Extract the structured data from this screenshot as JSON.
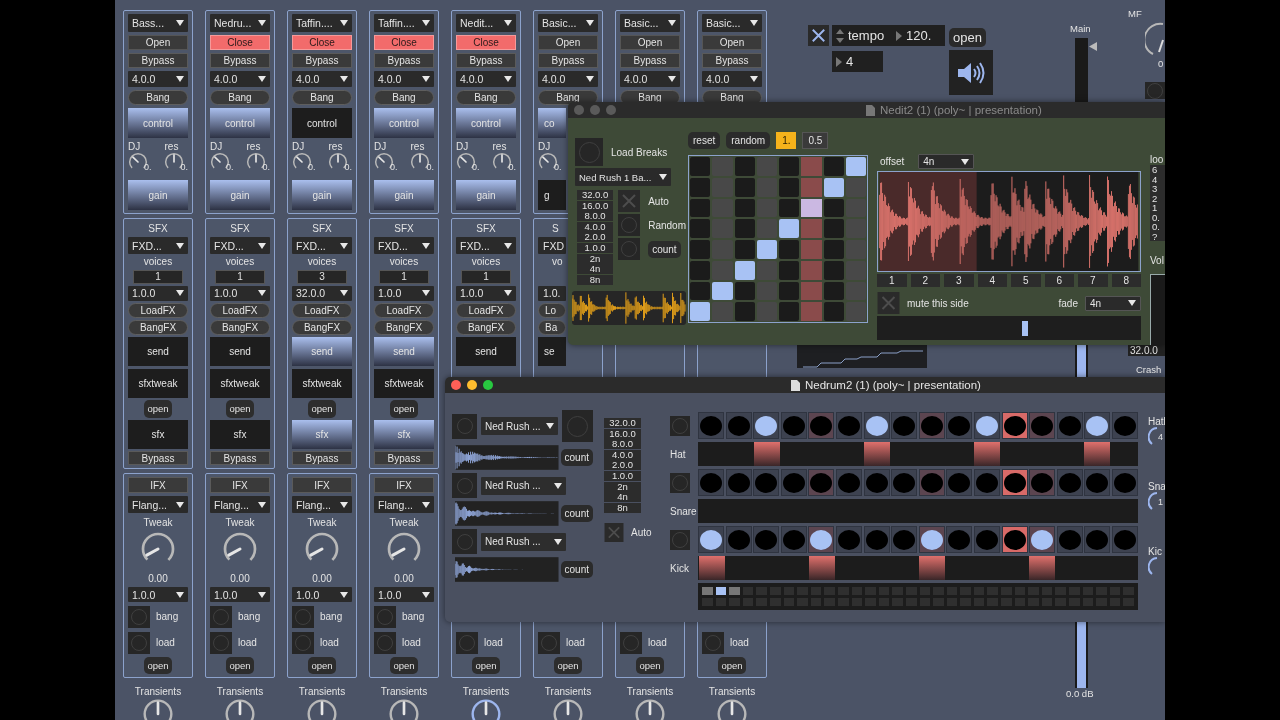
{
  "strips": [
    {
      "top": [
        {
          "kind": "preset",
          "text": "Bass..."
        },
        {
          "kind": "switch",
          "text": "Open",
          "on": false
        },
        {
          "kind": "bypass",
          "text": "Bypass"
        },
        {
          "kind": "rate",
          "text": "4.0.0"
        },
        {
          "kind": "bang",
          "text": "Bang"
        },
        {
          "kind": "control",
          "text": "control",
          "on": true
        },
        {
          "kind": "knobs",
          "knobs": [
            {
              "label": "DJ",
              "reading": "0."
            },
            {
              "label": "res",
              "reading": "0."
            }
          ]
        },
        {
          "kind": "gain",
          "text": "gain",
          "on": true
        }
      ],
      "sfx": [
        {
          "kind": "title",
          "text": "SFX"
        },
        {
          "kind": "effect",
          "text": "FXD..."
        },
        {
          "kind": "caption",
          "text": "voices"
        },
        {
          "kind": "voices",
          "text": "1"
        },
        {
          "kind": "rate",
          "text": "1.0.0"
        },
        {
          "kind": "load",
          "text": "LoadFX"
        },
        {
          "kind": "trigger",
          "text": "BangFX"
        },
        {
          "kind": "send",
          "text": "send",
          "on": false
        },
        {
          "kind": "tweak",
          "text": "sfxtweak"
        },
        {
          "kind": "open",
          "text": "open"
        },
        {
          "kind": "sfx",
          "text": "sfx",
          "on": false
        },
        {
          "kind": "bypass",
          "text": "Bypass"
        }
      ],
      "ifx": [
        {
          "kind": "tag",
          "text": "IFX"
        },
        {
          "kind": "effect",
          "text": "Flang..."
        },
        {
          "kind": "caption",
          "text": "Tweak"
        },
        {
          "kind": "dial"
        },
        {
          "kind": "reading",
          "text": "0.00"
        },
        {
          "kind": "rate",
          "text": "1.0.0"
        },
        {
          "kind": "bang",
          "text": "bang"
        },
        {
          "kind": "load",
          "text": "load"
        },
        {
          "kind": "open",
          "text": "open"
        }
      ],
      "transients": {
        "label": "Transients",
        "focused": false
      }
    },
    {
      "top": [
        {
          "kind": "preset",
          "text": "Nedru..."
        },
        {
          "kind": "switch",
          "text": "Close",
          "on": true
        },
        {
          "kind": "bypass",
          "text": "Bypass"
        },
        {
          "kind": "rate",
          "text": "4.0.0"
        },
        {
          "kind": "bang",
          "text": "Bang"
        },
        {
          "kind": "control",
          "text": "control",
          "on": true
        },
        {
          "kind": "knobs",
          "knobs": [
            {
              "label": "DJ",
              "reading": "0."
            },
            {
              "label": "res",
              "reading": "0."
            }
          ]
        },
        {
          "kind": "gain",
          "text": "gain",
          "on": true
        }
      ],
      "sfx": [
        {
          "kind": "title",
          "text": "SFX"
        },
        {
          "kind": "effect",
          "text": "FXD..."
        },
        {
          "kind": "caption",
          "text": "voices"
        },
        {
          "kind": "voices",
          "text": "1"
        },
        {
          "kind": "rate",
          "text": "1.0.0"
        },
        {
          "kind": "load",
          "text": "LoadFX"
        },
        {
          "kind": "trigger",
          "text": "BangFX"
        },
        {
          "kind": "send",
          "text": "send",
          "on": false
        },
        {
          "kind": "tweak",
          "text": "sfxtweak"
        },
        {
          "kind": "open",
          "text": "open"
        },
        {
          "kind": "sfx",
          "text": "sfx",
          "on": false
        },
        {
          "kind": "bypass",
          "text": "Bypass"
        }
      ],
      "ifx": [
        {
          "kind": "tag",
          "text": "IFX"
        },
        {
          "kind": "effect",
          "text": "Flang..."
        },
        {
          "kind": "caption",
          "text": "Tweak"
        },
        {
          "kind": "dial"
        },
        {
          "kind": "reading",
          "text": "0.00"
        },
        {
          "kind": "rate",
          "text": "1.0.0"
        },
        {
          "kind": "bang",
          "text": "bang"
        },
        {
          "kind": "load",
          "text": "load"
        },
        {
          "kind": "open",
          "text": "open"
        }
      ],
      "transients": {
        "label": "Transients",
        "focused": false
      }
    },
    {
      "top": [
        {
          "kind": "preset",
          "text": "Taffin...."
        },
        {
          "kind": "switch",
          "text": "Close",
          "on": true
        },
        {
          "kind": "bypass",
          "text": "Bypass"
        },
        {
          "kind": "rate",
          "text": "4.0.0"
        },
        {
          "kind": "bang",
          "text": "Bang"
        },
        {
          "kind": "control",
          "text": "control",
          "on": false
        },
        {
          "kind": "knobs",
          "knobs": [
            {
              "label": "DJ",
              "reading": "0."
            },
            {
              "label": "res",
              "reading": "0."
            }
          ]
        },
        {
          "kind": "gain",
          "text": "gain",
          "on": true
        }
      ],
      "sfx": [
        {
          "kind": "title",
          "text": "SFX"
        },
        {
          "kind": "effect",
          "text": "FXD..."
        },
        {
          "kind": "caption",
          "text": "voices"
        },
        {
          "kind": "voices",
          "text": "3"
        },
        {
          "kind": "rate",
          "text": "32.0.0"
        },
        {
          "kind": "load",
          "text": "LoadFX"
        },
        {
          "kind": "trigger",
          "text": "BangFX"
        },
        {
          "kind": "send",
          "text": "send",
          "on": true
        },
        {
          "kind": "tweak",
          "text": "sfxtweak"
        },
        {
          "kind": "open",
          "text": "open"
        },
        {
          "kind": "sfx",
          "text": "sfx",
          "on": true
        },
        {
          "kind": "bypass",
          "text": "Bypass"
        }
      ],
      "ifx": [
        {
          "kind": "tag",
          "text": "IFX"
        },
        {
          "kind": "effect",
          "text": "Flang..."
        },
        {
          "kind": "caption",
          "text": "Tweak"
        },
        {
          "kind": "dial"
        },
        {
          "kind": "reading",
          "text": "0.00"
        },
        {
          "kind": "rate",
          "text": "1.0.0"
        },
        {
          "kind": "bang",
          "text": "bang"
        },
        {
          "kind": "load",
          "text": "load"
        },
        {
          "kind": "open",
          "text": "open"
        }
      ],
      "transients": {
        "label": "Transients",
        "focused": false
      }
    },
    {
      "top": [
        {
          "kind": "preset",
          "text": "Taffin...."
        },
        {
          "kind": "switch",
          "text": "Close",
          "on": true
        },
        {
          "kind": "bypass",
          "text": "Bypass"
        },
        {
          "kind": "rate",
          "text": "4.0.0"
        },
        {
          "kind": "bang",
          "text": "Bang"
        },
        {
          "kind": "control",
          "text": "control",
          "on": true
        },
        {
          "kind": "knobs",
          "knobs": [
            {
              "label": "DJ",
              "reading": "0."
            },
            {
              "label": "res",
              "reading": "0."
            }
          ]
        },
        {
          "kind": "gain",
          "text": "gain",
          "on": true
        }
      ],
      "sfx": [
        {
          "kind": "title",
          "text": "SFX"
        },
        {
          "kind": "effect",
          "text": "FXD..."
        },
        {
          "kind": "caption",
          "text": "voices"
        },
        {
          "kind": "voices",
          "text": "1"
        },
        {
          "kind": "rate",
          "text": "1.0.0"
        },
        {
          "kind": "load",
          "text": "LoadFX"
        },
        {
          "kind": "trigger",
          "text": "BangFX"
        },
        {
          "kind": "send",
          "text": "send",
          "on": true
        },
        {
          "kind": "tweak",
          "text": "sfxtweak"
        },
        {
          "kind": "open",
          "text": "open"
        },
        {
          "kind": "sfx",
          "text": "sfx",
          "on": true
        },
        {
          "kind": "bypass",
          "text": "Bypass"
        }
      ],
      "ifx": [
        {
          "kind": "tag",
          "text": "IFX"
        },
        {
          "kind": "effect",
          "text": "Flang..."
        },
        {
          "kind": "caption",
          "text": "Tweak"
        },
        {
          "kind": "dial"
        },
        {
          "kind": "reading",
          "text": "0.00"
        },
        {
          "kind": "rate",
          "text": "1.0.0"
        },
        {
          "kind": "bang",
          "text": "bang"
        },
        {
          "kind": "load",
          "text": "load"
        },
        {
          "kind": "open",
          "text": "open"
        }
      ],
      "transients": {
        "label": "Transients",
        "focused": false
      }
    },
    {
      "top": [
        {
          "kind": "preset",
          "text": "Nedit..."
        },
        {
          "kind": "switch",
          "text": "Close",
          "on": true
        },
        {
          "kind": "bypass",
          "text": "Bypass"
        },
        {
          "kind": "rate",
          "text": "4.0.0"
        },
        {
          "kind": "bang",
          "text": "Bang"
        },
        {
          "kind": "control",
          "text": "control",
          "on": true
        },
        {
          "kind": "knobs",
          "knobs": [
            {
              "label": "DJ",
              "reading": "0."
            },
            {
              "label": "res",
              "reading": "0."
            }
          ]
        },
        {
          "kind": "gain",
          "text": "gain",
          "on": true
        }
      ],
      "sfx": [
        {
          "kind": "title",
          "text": "SFX"
        },
        {
          "kind": "effect",
          "text": "FXD..."
        },
        {
          "kind": "caption",
          "text": "voices"
        },
        {
          "kind": "voices",
          "text": "1"
        },
        {
          "kind": "rate",
          "text": "1.0.0"
        },
        {
          "kind": "load",
          "text": "LoadFX"
        },
        {
          "kind": "trigger",
          "text": "BangFX"
        },
        {
          "kind": "send",
          "text": "send",
          "on": false
        }
      ],
      "ifx": [
        {
          "kind": "load",
          "text": "load"
        },
        {
          "kind": "open",
          "text": "open"
        }
      ],
      "transients": {
        "label": "Transients",
        "focused": true
      }
    },
    {
      "top": [
        {
          "kind": "preset",
          "text": "Basic..."
        },
        {
          "kind": "switch",
          "text": "Open",
          "on": false
        },
        {
          "kind": "bypass",
          "text": "Bypass"
        },
        {
          "kind": "rate",
          "text": "4.0.0"
        },
        {
          "kind": "bang",
          "text": "Bang"
        },
        {
          "kind": "control",
          "text": "co",
          "on": true,
          "cut": true
        },
        {
          "kind": "knobs",
          "knobs": [
            {
              "label": "DJ",
              "reading": "0."
            }
          ]
        },
        {
          "kind": "gain",
          "text": "g",
          "on": false,
          "cut": true
        }
      ],
      "sfx": [
        {
          "kind": "title",
          "text": "S",
          "cut": true
        },
        {
          "kind": "effect",
          "text": "FXD",
          "cut": true
        },
        {
          "kind": "caption",
          "text": "vo",
          "cut": true
        },
        {
          "kind": "rate",
          "text": "1.0.",
          "cut": true
        },
        {
          "kind": "load",
          "text": "Lo",
          "cut": true
        },
        {
          "kind": "trigger",
          "text": "Ba",
          "cut": true
        },
        {
          "kind": "send",
          "text": "se",
          "on": false,
          "cut": true
        }
      ],
      "ifx": [
        {
          "kind": "load",
          "text": "load"
        },
        {
          "kind": "open",
          "text": "open"
        }
      ],
      "transients": {
        "label": "Transients",
        "focused": false
      }
    },
    {
      "top": [
        {
          "kind": "preset",
          "text": "Basic..."
        },
        {
          "kind": "switch",
          "text": "Open",
          "on": false
        },
        {
          "kind": "bypass",
          "text": "Bypass"
        },
        {
          "kind": "rate",
          "text": "4.0.0"
        },
        {
          "kind": "bang",
          "text": "Bang"
        }
      ],
      "ifx": [
        {
          "kind": "load",
          "text": "load"
        },
        {
          "kind": "open",
          "text": "open"
        }
      ],
      "transients": {
        "label": "Transients",
        "focused": false
      }
    },
    {
      "top": [
        {
          "kind": "preset",
          "text": "Basic..."
        },
        {
          "kind": "switch",
          "text": "Open",
          "on": false
        },
        {
          "kind": "bypass",
          "text": "Bypass"
        },
        {
          "kind": "rate",
          "text": "4.0.0"
        },
        {
          "kind": "bang",
          "text": "Bang"
        }
      ],
      "ifx": [
        {
          "kind": "load",
          "text": "load"
        },
        {
          "kind": "open",
          "text": "open"
        }
      ],
      "transients": {
        "label": "Transients",
        "focused": false
      }
    }
  ],
  "transport": {
    "toggle": {
      "checked": true
    },
    "tempo": "tempo",
    "bpm": "120.",
    "beats": "4",
    "open": "open",
    "main": "Main",
    "fader": {
      "level": 0.55
    },
    "db": "0.0 dB",
    "mfx": "MF",
    "mfx_reading": "0",
    "crash_menu": "32.0.0",
    "crash": "Crash"
  },
  "editor": {
    "title": "Nedit2 (1) (poly~ |  presentation)",
    "focused": false,
    "load_label": "Load Breaks",
    "breaks_menu": "Ned Rush 1 Ba...",
    "rates": [
      "32.0.0",
      "16.0.0",
      "8.0.0",
      "4.0.0",
      "2.0.0",
      "1.0.0",
      "2n",
      "4n",
      "8n"
    ],
    "auto": {
      "label": "Auto",
      "checked": false
    },
    "random": {
      "label": "Random"
    },
    "count": "count",
    "buttons": [
      "reset",
      "random"
    ],
    "speeds": [
      {
        "text": "1.",
        "selected": true
      },
      {
        "text": "0.5",
        "selected": false
      }
    ],
    "grid": [
      {
        "playing": false,
        "cells": [
          false,
          false,
          false,
          false,
          false,
          false,
          false,
          true
        ]
      },
      {
        "playing": false,
        "cells": [
          false,
          false,
          false,
          false,
          false,
          false,
          true,
          false
        ]
      },
      {
        "playing": false,
        "cells": [
          false,
          false,
          false,
          false,
          false,
          true,
          false,
          false
        ]
      },
      {
        "playing": false,
        "cells": [
          false,
          false,
          false,
          false,
          true,
          false,
          false,
          false
        ]
      },
      {
        "playing": false,
        "cells": [
          false,
          false,
          false,
          true,
          false,
          false,
          false,
          false
        ]
      },
      {
        "playing": true,
        "cells": [
          false,
          false,
          true,
          false,
          false,
          false,
          false,
          false
        ]
      },
      {
        "playing": false,
        "cells": [
          false,
          true,
          false,
          false,
          false,
          false,
          false,
          false
        ]
      },
      {
        "playing": false,
        "cells": [
          true,
          false,
          false,
          false,
          false,
          false,
          false,
          false
        ]
      }
    ],
    "offset": {
      "label": "offset",
      "value": "4n"
    },
    "region": {
      "level": 0.375
    },
    "slices": [
      "1",
      "2",
      "3",
      "4",
      "5",
      "6",
      "7",
      "8"
    ],
    "mute": {
      "label": "mute this side",
      "checked": false
    },
    "fade": {
      "label": "fade",
      "value": "4n"
    },
    "position": {
      "level": 0.55
    },
    "side": {
      "label": "loo",
      "values": [
        "6",
        "4",
        "3",
        "2",
        "1",
        "0.",
        "0.",
        "?"
      ],
      "vol": "Vol"
    }
  },
  "drum": {
    "title": "Nedrum2 (1) (poly~ |  presentation)",
    "focused": true,
    "samples": [
      {
        "menu": "Ned Rush ...",
        "count": "count"
      },
      {
        "menu": "Ned Rush ...",
        "count": "count"
      },
      {
        "menu": "Ned Rush ...",
        "count": "count"
      }
    ],
    "rates": [
      "32.0.0",
      "16.0.0",
      "8.0.0",
      "4.0.0",
      "2.0.0",
      "1.0.0",
      "2n",
      "4n",
      "8n"
    ],
    "auto": {
      "label": "Auto",
      "checked": false
    },
    "beats": [
      {
        "playing": false
      },
      {
        "playing": false
      },
      {
        "playing": false
      },
      {
        "playing": false
      },
      {
        "playing": false
      },
      {
        "playing": false
      },
      {
        "playing": false
      },
      {
        "playing": false
      },
      {
        "playing": false
      },
      {
        "playing": false
      },
      {
        "playing": false
      },
      {
        "playing": true
      },
      {
        "playing": false
      },
      {
        "playing": false
      },
      {
        "playing": false
      },
      {
        "playing": false
      }
    ],
    "tracks": [
      {
        "label": "Hat",
        "steps": [
          {
            "on": false
          },
          {
            "on": false
          },
          {
            "on": true
          },
          {
            "on": false
          },
          {
            "on": false
          },
          {
            "on": false
          },
          {
            "on": true
          },
          {
            "on": false
          },
          {
            "on": false
          },
          {
            "on": false
          },
          {
            "on": true
          },
          {
            "on": false
          },
          {
            "on": false
          },
          {
            "on": false
          },
          {
            "on": true
          },
          {
            "on": false
          }
        ]
      },
      {
        "label": "Snare",
        "steps": [
          {
            "on": false
          },
          {
            "on": false
          },
          {
            "on": false
          },
          {
            "on": false
          },
          {
            "on": false
          },
          {
            "on": false
          },
          {
            "on": false
          },
          {
            "on": false
          },
          {
            "on": false
          },
          {
            "on": false
          },
          {
            "on": false
          },
          {
            "on": false
          },
          {
            "on": false
          },
          {
            "on": false
          },
          {
            "on": false
          },
          {
            "on": false
          }
        ]
      },
      {
        "label": "Kick",
        "steps": [
          {
            "on": true
          },
          {
            "on": false
          },
          {
            "on": false
          },
          {
            "on": false
          },
          {
            "on": true
          },
          {
            "on": false
          },
          {
            "on": false
          },
          {
            "on": false
          },
          {
            "on": true
          },
          {
            "on": false
          },
          {
            "on": false
          },
          {
            "on": false
          },
          {
            "on": true
          },
          {
            "on": false
          },
          {
            "on": false
          },
          {
            "on": false
          }
        ]
      }
    ],
    "pages": [
      {
        "selected": false
      },
      {
        "selected": true
      },
      {
        "selected": false
      }
    ],
    "levels": [
      {
        "label": "Hatl",
        "reading": "4"
      },
      {
        "label": "Sna",
        "reading": "1"
      },
      {
        "label": "Kic"
      }
    ]
  }
}
